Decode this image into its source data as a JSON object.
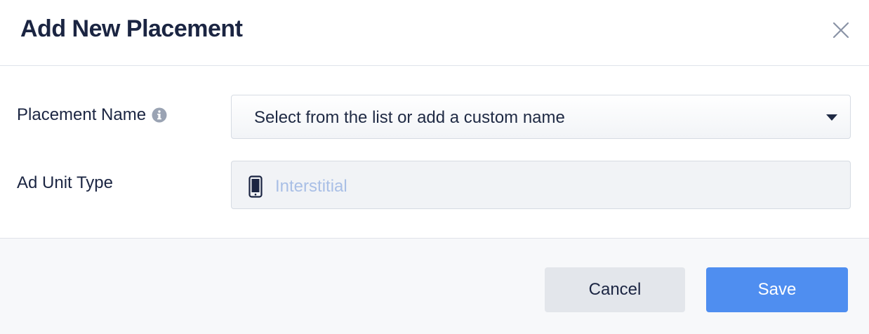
{
  "dialog": {
    "title": "Add New Placement",
    "close_icon": "close-icon"
  },
  "form": {
    "placement_name": {
      "label": "Placement Name",
      "info_icon": "info-icon",
      "placeholder": "Select from the list or add a custom name",
      "caret_icon": "caret-down-icon"
    },
    "ad_unit_type": {
      "label": "Ad Unit Type",
      "icon": "mobile-phone-icon",
      "value": "Interstitial"
    }
  },
  "footer": {
    "cancel_label": "Cancel",
    "save_label": "Save"
  },
  "colors": {
    "primary": "#4f8ef0",
    "title_text": "#1b2542",
    "readonly_text": "#a9bfe6",
    "footer_bg": "#f7f8fa"
  }
}
